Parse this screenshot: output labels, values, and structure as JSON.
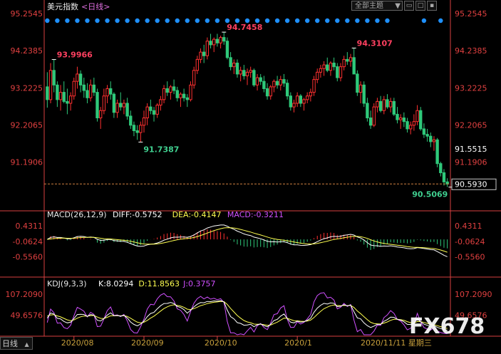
{
  "header": {
    "symbol": "美元指数",
    "period": "<日线>"
  },
  "toolbar": {
    "theme_label": "全部主题",
    "dropdown_glyph": "▼",
    "icons": [
      "restore-icon",
      "maximize-icon",
      "close-icon"
    ]
  },
  "bottom": {
    "tab_label": "日线",
    "watermark": "FX678"
  },
  "colors": {
    "up": "#ff3030",
    "down": "#2fc97a",
    "diff": "#ffffff",
    "dea": "#ffff50",
    "macd": "#d050ff",
    "kdj_k": "#ffffff",
    "kdj_d": "#ffff50",
    "kdj_j": "#d050ff",
    "axis": "#d84040",
    "date": "#c8a03c",
    "marker": "#1e90ff"
  },
  "chart_data": [
    {
      "type": "candlestick",
      "title": "美元指数 <日线>",
      "y_ticks": [
        95.2545,
        94.2385,
        93.2225,
        92.2065,
        91.1906
      ],
      "ylim": [
        90.17,
        95.2545
      ],
      "last_price": "90.5930",
      "cursor_value": "91.5515",
      "annotations": [
        {
          "label": "93.9966",
          "value": 93.9966,
          "bar": 2,
          "kind": "high"
        },
        {
          "label": "91.7387",
          "value": 91.7387,
          "bar": 28,
          "kind": "low"
        },
        {
          "label": "94.7458",
          "value": 94.7458,
          "bar": 53,
          "kind": "high"
        },
        {
          "label": "94.3107",
          "value": 94.3107,
          "bar": 92,
          "kind": "high"
        },
        {
          "label": "90.5069",
          "value": 90.5069,
          "bar": 121,
          "kind": "low"
        }
      ],
      "x_tick_labels": [
        {
          "label": "2020/08",
          "bar": 8
        },
        {
          "label": "2020/09",
          "bar": 29
        },
        {
          "label": "2020/10",
          "bar": 51
        },
        {
          "label": "2020/1",
          "bar": 75
        }
      ],
      "x_cursor_label": "2020/11/11 星期三",
      "ohlc": [
        [
          93.25,
          93.65,
          92.68,
          92.9
        ],
        [
          92.9,
          93.9,
          92.8,
          93.7
        ],
        [
          93.7,
          94.0,
          93.1,
          93.3
        ],
        [
          93.3,
          93.4,
          92.7,
          92.9
        ],
        [
          92.9,
          93.3,
          92.6,
          93.1
        ],
        [
          93.1,
          93.4,
          92.8,
          92.85
        ],
        [
          92.85,
          93.2,
          92.5,
          92.8
        ],
        [
          92.8,
          93.1,
          92.6,
          93.0
        ],
        [
          93.0,
          93.5,
          92.9,
          93.4
        ],
        [
          93.4,
          93.8,
          93.2,
          93.6
        ],
        [
          93.6,
          93.7,
          93.1,
          93.3
        ],
        [
          93.3,
          93.5,
          92.95,
          93.15
        ],
        [
          93.15,
          93.35,
          92.8,
          92.95
        ],
        [
          92.95,
          93.45,
          92.85,
          93.3
        ],
        [
          93.3,
          93.5,
          93.0,
          93.1
        ],
        [
          93.1,
          93.2,
          92.3,
          92.4
        ],
        [
          92.4,
          92.7,
          92.1,
          92.6
        ],
        [
          92.6,
          93.2,
          92.5,
          93.0
        ],
        [
          93.0,
          93.3,
          92.8,
          93.2
        ],
        [
          93.2,
          93.4,
          92.9,
          93.05
        ],
        [
          93.05,
          93.1,
          92.4,
          92.55
        ],
        [
          92.55,
          92.9,
          92.4,
          92.8
        ],
        [
          92.8,
          93.1,
          92.6,
          92.7
        ],
        [
          92.7,
          92.9,
          92.5,
          92.8
        ],
        [
          92.8,
          92.95,
          92.35,
          92.45
        ],
        [
          92.45,
          92.6,
          92.1,
          92.2
        ],
        [
          92.2,
          92.3,
          91.9,
          92.05
        ],
        [
          92.05,
          92.2,
          91.8,
          92.0
        ],
        [
          92.0,
          92.3,
          91.74,
          92.2
        ],
        [
          92.2,
          92.6,
          92.0,
          92.4
        ],
        [
          92.4,
          92.8,
          92.2,
          92.7
        ],
        [
          92.7,
          92.9,
          92.5,
          92.6
        ],
        [
          92.6,
          92.7,
          92.3,
          92.5
        ],
        [
          92.5,
          92.8,
          92.4,
          92.75
        ],
        [
          92.75,
          93.0,
          92.6,
          92.9
        ],
        [
          92.9,
          93.3,
          92.8,
          93.2
        ],
        [
          93.2,
          93.4,
          93.0,
          93.1
        ],
        [
          93.1,
          93.3,
          92.9,
          93.25
        ],
        [
          93.25,
          93.45,
          93.05,
          93.15
        ],
        [
          93.15,
          93.25,
          92.85,
          92.95
        ],
        [
          92.95,
          93.1,
          92.7,
          93.05
        ],
        [
          93.05,
          93.2,
          92.85,
          92.95
        ],
        [
          92.95,
          93.05,
          92.7,
          92.9
        ],
        [
          92.9,
          93.4,
          92.85,
          93.3
        ],
        [
          93.3,
          93.8,
          93.2,
          93.7
        ],
        [
          93.7,
          94.1,
          93.6,
          94.0
        ],
        [
          94.0,
          94.3,
          93.9,
          94.2
        ],
        [
          94.2,
          94.4,
          93.9,
          94.1
        ],
        [
          94.1,
          94.6,
          94.0,
          94.5
        ],
        [
          94.5,
          94.7,
          94.3,
          94.4
        ],
        [
          94.4,
          94.6,
          94.2,
          94.55
        ],
        [
          94.55,
          94.7,
          94.35,
          94.45
        ],
        [
          94.45,
          94.65,
          94.3,
          94.6
        ],
        [
          94.6,
          94.75,
          94.4,
          94.5
        ],
        [
          94.5,
          94.6,
          94.0,
          94.05
        ],
        [
          94.05,
          94.2,
          93.7,
          93.8
        ],
        [
          93.8,
          94.0,
          93.6,
          93.9
        ],
        [
          93.9,
          94.0,
          93.5,
          93.6
        ],
        [
          93.6,
          93.8,
          93.4,
          93.7
        ],
        [
          93.7,
          93.85,
          93.45,
          93.55
        ],
        [
          93.55,
          93.75,
          93.3,
          93.65
        ],
        [
          93.65,
          93.8,
          93.5,
          93.7
        ],
        [
          93.7,
          93.75,
          93.25,
          93.3
        ],
        [
          93.3,
          93.6,
          93.15,
          93.5
        ],
        [
          93.5,
          93.6,
          93.3,
          93.4
        ],
        [
          93.4,
          93.55,
          93.1,
          93.2
        ],
        [
          93.2,
          93.35,
          92.9,
          93.0
        ],
        [
          93.0,
          93.3,
          92.9,
          93.25
        ],
        [
          93.25,
          93.45,
          93.1,
          93.4
        ],
        [
          93.4,
          93.55,
          93.2,
          93.3
        ],
        [
          93.3,
          93.55,
          93.15,
          93.45
        ],
        [
          93.45,
          93.6,
          93.25,
          93.35
        ],
        [
          93.35,
          93.45,
          92.9,
          93.0
        ],
        [
          93.0,
          93.1,
          92.6,
          92.7
        ],
        [
          92.7,
          92.9,
          92.55,
          92.8
        ],
        [
          92.8,
          93.1,
          92.7,
          93.0
        ],
        [
          93.0,
          93.05,
          92.7,
          92.8
        ],
        [
          92.8,
          92.95,
          92.6,
          92.9
        ],
        [
          92.9,
          93.1,
          92.8,
          93.0
        ],
        [
          93.0,
          93.2,
          92.85,
          93.1
        ],
        [
          93.1,
          93.55,
          93.0,
          93.45
        ],
        [
          93.45,
          93.75,
          93.35,
          93.65
        ],
        [
          93.65,
          93.85,
          93.5,
          93.75
        ],
        [
          93.75,
          93.95,
          93.55,
          93.85
        ],
        [
          93.85,
          94.05,
          93.65,
          93.7
        ],
        [
          93.7,
          93.95,
          93.55,
          93.9
        ],
        [
          93.9,
          94.05,
          93.7,
          93.8
        ],
        [
          93.8,
          93.9,
          93.4,
          93.5
        ],
        [
          93.5,
          93.9,
          93.4,
          93.8
        ],
        [
          93.8,
          94.1,
          93.7,
          94.0
        ],
        [
          94.0,
          94.2,
          93.85,
          93.95
        ],
        [
          93.95,
          94.15,
          93.8,
          94.05
        ],
        [
          94.05,
          94.31,
          93.9,
          93.6
        ],
        [
          93.6,
          93.7,
          93.0,
          93.1
        ],
        [
          93.1,
          93.4,
          92.8,
          93.3
        ],
        [
          93.3,
          93.4,
          92.7,
          92.8
        ],
        [
          92.8,
          92.95,
          92.3,
          92.4
        ],
        [
          92.4,
          92.6,
          92.1,
          92.2
        ],
        [
          92.2,
          92.8,
          92.15,
          92.7
        ],
        [
          92.7,
          92.95,
          92.55,
          92.85
        ],
        [
          92.85,
          93.0,
          92.55,
          92.6
        ],
        [
          92.6,
          93.0,
          92.5,
          92.9
        ],
        [
          92.9,
          93.05,
          92.65,
          92.7
        ],
        [
          92.7,
          92.95,
          92.55,
          92.85
        ],
        [
          92.85,
          92.95,
          92.45,
          92.5
        ],
        [
          92.5,
          92.7,
          92.25,
          92.35
        ],
        [
          92.35,
          92.5,
          92.1,
          92.4
        ],
        [
          92.4,
          92.55,
          92.15,
          92.3
        ],
        [
          92.3,
          92.4,
          92.0,
          92.1
        ],
        [
          92.1,
          92.3,
          91.95,
          92.2
        ],
        [
          92.2,
          92.5,
          92.05,
          92.3
        ],
        [
          92.3,
          92.75,
          92.2,
          92.6
        ],
        [
          92.6,
          92.7,
          92.05,
          92.1
        ],
        [
          92.1,
          92.25,
          91.85,
          91.95
        ],
        [
          91.95,
          92.1,
          91.75,
          91.9
        ],
        [
          91.9,
          92.0,
          91.6,
          91.75
        ],
        [
          91.75,
          91.9,
          91.5,
          91.8
        ],
        [
          91.8,
          91.85,
          91.05,
          91.15
        ],
        [
          91.15,
          91.2,
          90.8,
          90.9
        ],
        [
          90.9,
          91.0,
          90.55,
          90.65
        ],
        [
          90.65,
          90.75,
          90.51,
          90.59
        ]
      ]
    },
    {
      "type": "line",
      "title": "MACD(26,12,9)",
      "items": [
        {
          "label": "DIFF:-0.5752",
          "color": "#ffffff"
        },
        {
          "label": "DEA:-0.4147",
          "color": "#ffff50"
        },
        {
          "label": "MACD:-0.3211",
          "color": "#d050ff"
        }
      ],
      "y_ticks": [
        0.4311,
        -0.0624,
        -0.556
      ],
      "y_tick_labels": [
        "0.4311",
        "-0.0624",
        "-0.5560"
      ],
      "ylim": [
        -0.82,
        0.55
      ]
    },
    {
      "type": "line",
      "title": "KDJ(9,3,3)",
      "items": [
        {
          "label": "K:8.0294",
          "color": "#ffffff"
        },
        {
          "label": "D:11.8563",
          "color": "#ffff50"
        },
        {
          "label": "J:0.3757",
          "color": "#d050ff"
        }
      ],
      "y_ticks": [
        107.209,
        49.6576
      ],
      "y_tick_labels": [
        "107.2090",
        "49.6576"
      ],
      "ylim": [
        -5,
        125
      ]
    }
  ]
}
